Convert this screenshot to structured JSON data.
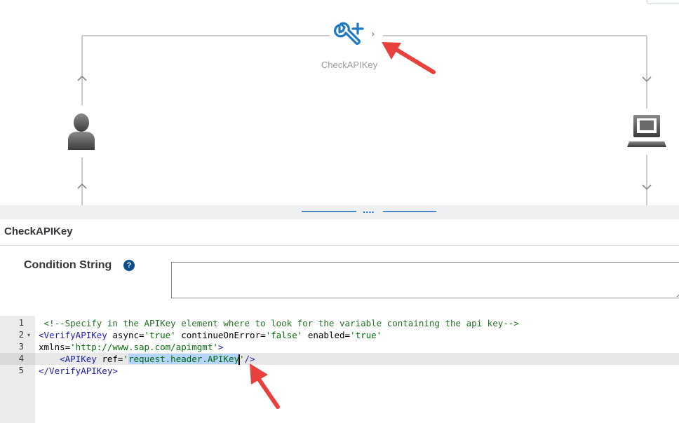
{
  "flow": {
    "policy_label": "CheckAPIKey",
    "policy_icon": "wrench-plus-icon",
    "chevron": "›",
    "left_endpoint_icon": "user-icon",
    "right_endpoint_icon": "laptop-icon"
  },
  "details": {
    "title": "CheckAPIKey",
    "condition_label": "Condition String",
    "help_glyph": "?",
    "condition_value": ""
  },
  "editor": {
    "lines": [
      {
        "no": "1",
        "fold": "",
        "parts": [
          {
            "cls": "tok-comment",
            "text": " <!--Specify in the APIKey element where to look for the variable containing the api key-->"
          }
        ]
      },
      {
        "no": "2",
        "fold": "▾",
        "parts": [
          {
            "cls": "tok-tag",
            "text": "<VerifyAPIKey"
          },
          {
            "cls": "tok-attr",
            "text": " async="
          },
          {
            "cls": "tok-str",
            "text": "'true'"
          },
          {
            "cls": "tok-attr",
            "text": " continueOnError="
          },
          {
            "cls": "tok-str",
            "text": "'false'"
          },
          {
            "cls": "tok-attr",
            "text": " enabled="
          },
          {
            "cls": "tok-str",
            "text": "'true'"
          }
        ]
      },
      {
        "no": "3",
        "fold": "",
        "parts": [
          {
            "cls": "tok-attr",
            "text": "xmlns="
          },
          {
            "cls": "tok-str",
            "text": "'http://www.sap.com/apimgmt'"
          },
          {
            "cls": "tok-tag",
            "text": ">"
          }
        ]
      },
      {
        "no": "4",
        "fold": "",
        "active": true,
        "parts": [
          {
            "cls": "tok-tag",
            "text": "    <APIKey"
          },
          {
            "cls": "tok-attr",
            "text": " ref="
          },
          {
            "cls": "tok-str",
            "text": "'"
          },
          {
            "cls": "tok-sel",
            "text": "request.header.APIKey"
          },
          {
            "cls": "cursor",
            "text": ""
          },
          {
            "cls": "tok-str",
            "text": "'"
          },
          {
            "cls": "tok-tag",
            "text": "/>"
          }
        ]
      },
      {
        "no": "5",
        "fold": "",
        "parts": [
          {
            "cls": "tok-tag",
            "text": "</VerifyAPIKey>"
          }
        ]
      }
    ]
  },
  "colors": {
    "accent": "#0a6ed1",
    "annotation": "#e8413d",
    "icon_gray": "#555555"
  }
}
